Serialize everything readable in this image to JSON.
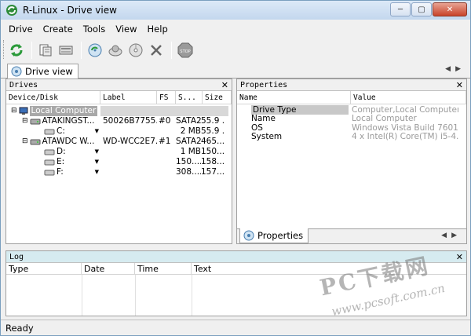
{
  "window": {
    "title": "R-Linux - Drive view"
  },
  "menu": [
    "Drive",
    "Create",
    "Tools",
    "View",
    "Help"
  ],
  "doc_tab": {
    "label": "Drive view"
  },
  "drives_panel": {
    "title": "Drives",
    "columns": [
      "Device/Disk",
      "Label",
      "FS",
      "S...",
      "Size"
    ],
    "rows": [
      {
        "name": "Local Computer",
        "label": "",
        "fs": "",
        "s": "",
        "size": ""
      },
      {
        "name": "ATAKINGST...",
        "label": "50026B7755...",
        "fs": "#0",
        "s": "SATA2...",
        "size": "55.9 ..."
      },
      {
        "name": "C:",
        "label": "",
        "fs": "",
        "s": "2 MB",
        "size": "55.9 ..."
      },
      {
        "name": "ATAWDC W...",
        "label": "WD-WCC2E7...",
        "fs": "#1",
        "s": "SATA2...",
        "size": "465...."
      },
      {
        "name": "D:",
        "label": "",
        "fs": "",
        "s": "1 MB",
        "size": "150...."
      },
      {
        "name": "E:",
        "label": "",
        "fs": "",
        "s": "150....",
        "size": "158...."
      },
      {
        "name": "F:",
        "label": "",
        "fs": "",
        "s": "308....",
        "size": "157...."
      }
    ]
  },
  "properties_panel": {
    "title": "Properties",
    "columns": [
      "Name",
      "Value"
    ],
    "rows": [
      {
        "name": "Drive Type",
        "value": "Computer,Local Computer"
      },
      {
        "name": "Name",
        "value": "Local Computer"
      },
      {
        "name": "OS",
        "value": "Windows Vista Build 7601..."
      },
      {
        "name": "System",
        "value": "4 x Intel(R) Core(TM) i5-4..."
      }
    ],
    "tab_label": "Properties"
  },
  "log_panel": {
    "title": "Log",
    "columns": [
      "Type",
      "Date",
      "Time",
      "Text"
    ]
  },
  "status": {
    "text": "Ready"
  },
  "watermark": {
    "line1": "PC下载网",
    "line2": "www.pcsoft.com.cn"
  }
}
